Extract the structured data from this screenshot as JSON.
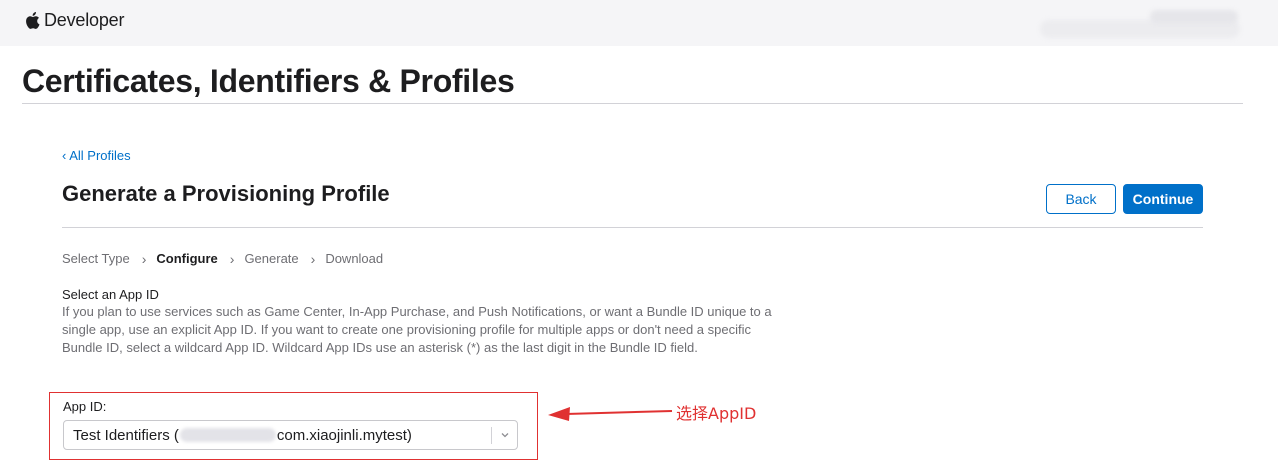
{
  "header": {
    "brand_label": "Developer"
  },
  "page": {
    "title": "Certificates, Identifiers & Profiles"
  },
  "nav": {
    "back_link": "‹ All Profiles"
  },
  "section": {
    "title": "Generate a Provisioning Profile",
    "back_button": "Back",
    "continue_button": "Continue"
  },
  "steps": [
    {
      "label": "Select Type",
      "active": false
    },
    {
      "label": "Configure",
      "active": true
    },
    {
      "label": "Generate",
      "active": false
    },
    {
      "label": "Download",
      "active": false
    }
  ],
  "select_app_id": {
    "heading": "Select an App ID",
    "description": "If you plan to use services such as Game Center, In-App Purchase, and Push Notifications, or want a Bundle ID unique to a single app, use an explicit App ID. If you want to create one provisioning profile for multiple apps or don't need a specific Bundle ID, select a wildcard App ID. Wildcard App IDs use an asterisk (*) as the last digit in the Bundle ID field.",
    "field_label": "App ID:",
    "value_prefix": "Test Identifiers (",
    "value_suffix": "com.xiaojinli.mytest)"
  },
  "annotation": {
    "text": "选择AppID",
    "color": "#e03131"
  },
  "colors": {
    "accent": "#0070c9",
    "highlight": "#e03131"
  },
  "icons": {
    "brand": "apple-logo-icon",
    "step_separator": "chevron-right-icon",
    "select": "chevron-down-icon"
  }
}
